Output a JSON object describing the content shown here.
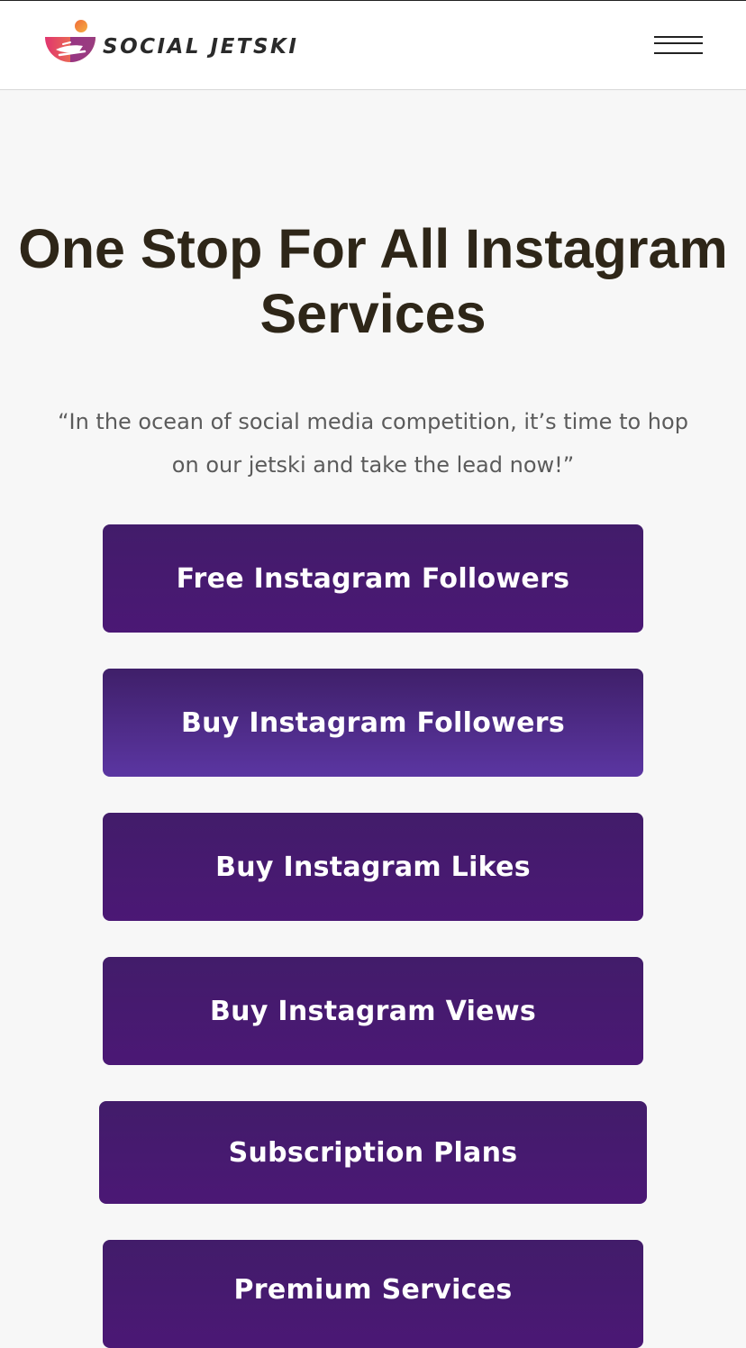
{
  "header": {
    "logo_text": "SOCIAL JETSKI",
    "menu_icon": "hamburger-menu-icon"
  },
  "hero": {
    "title_line1": "One Stop For All Instagram",
    "title_line2": "Services",
    "quote_line1": "“In the ocean of social media competition, it’s time to hop",
    "quote_line2": "on our jetski and take the lead now!”"
  },
  "services": [
    {
      "label": "Free Instagram Followers"
    },
    {
      "label": "Buy Instagram Followers"
    },
    {
      "label": "Buy Instagram Likes"
    },
    {
      "label": "Buy Instagram Views"
    },
    {
      "label": "Subscription Plans"
    },
    {
      "label": "Premium Services"
    }
  ],
  "colors": {
    "button_purple": "#461a70",
    "button_highlight": "#5b36a2",
    "title_color": "#2e2618",
    "logo_gradient_start": "#e0356f",
    "logo_gradient_end": "#f39a3a"
  }
}
